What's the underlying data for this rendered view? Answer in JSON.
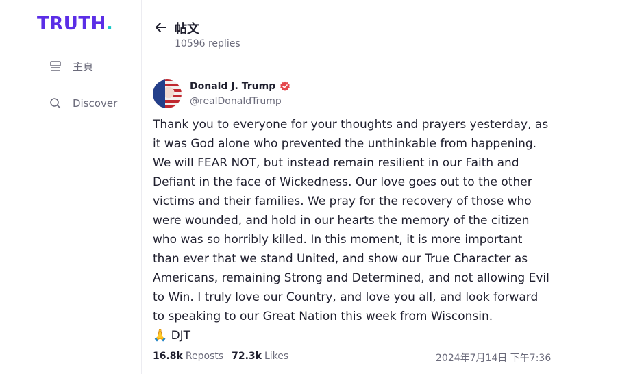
{
  "brand": {
    "name": "TRUTH",
    "dot": "."
  },
  "sidebar": {
    "items": [
      {
        "label": "主頁",
        "icon": "home-icon"
      },
      {
        "label": "Discover",
        "icon": "search-icon"
      }
    ]
  },
  "header": {
    "title": "帖文",
    "replies": "10596 replies"
  },
  "post": {
    "author": "Donald J. Trump",
    "handle": "@realDonaldTrump",
    "lines": [
      "Thank you to everyone for your thoughts and prayers yesterday, as",
      "it was God alone who prevented the unthinkable from happening.",
      "We will FEAR NOT, but instead remain resilient in our Faith and",
      "Defiant in the face of Wickedness. Our love goes out to the other",
      "victims and their families. We pray for the recovery of those who",
      "were wounded, and hold in our hearts the memory of the citizen",
      "who was so horribly killed. In this moment, it is more important",
      "than ever that we stand United, and show our True Character as",
      "Americans, remaining Strong and Determined, and not allowing Evil",
      "to Win. I truly love our Country, and love you all, and look forward",
      "to speaking to our Great Nation this week from Wisconsin."
    ],
    "signoff": "🙏 DJT",
    "reposts_count": "16.8k",
    "reposts_label": "Reposts",
    "likes_count": "72.3k",
    "likes_label": "Likes",
    "timestamp": "2024年7月14日 下午7:36"
  },
  "colors": {
    "brand": "#5b2ee6",
    "brand_dot": "#17c7c7",
    "verified": "#e5484d"
  }
}
